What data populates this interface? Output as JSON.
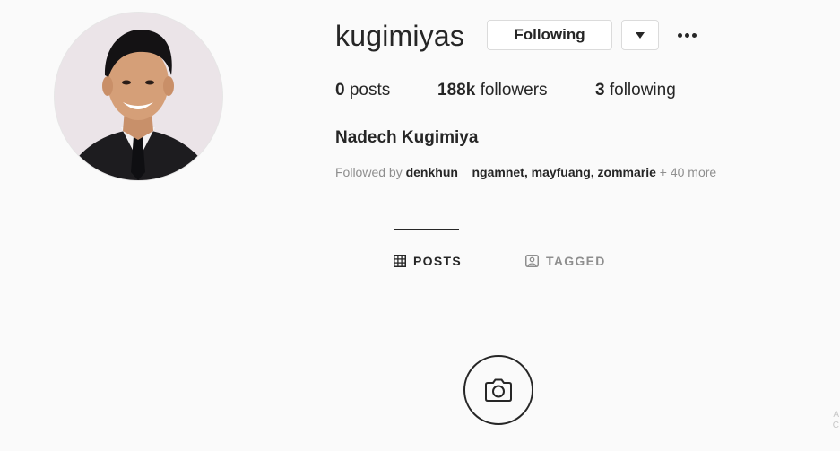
{
  "profile": {
    "username": "kugimiyas",
    "full_name": "Nadech Kugimiya",
    "avatar_alt": "profile-photo"
  },
  "actions": {
    "following_label": "Following",
    "dropdown_icon": "caret-down-icon",
    "more_icon": "more-horizontal-icon"
  },
  "stats": {
    "posts_count": "0",
    "posts_label": "posts",
    "followers_count": "188k",
    "followers_label": "followers",
    "following_count": "3",
    "following_label": "following"
  },
  "followed_by": {
    "prefix": "Followed by",
    "users": [
      "denkhun__ngamnet",
      "mayfuang",
      "zommarie"
    ],
    "more": "+ 40 more"
  },
  "tabs": [
    {
      "label": "POSTS",
      "icon": "grid-icon",
      "active": true
    },
    {
      "label": "TAGGED",
      "icon": "tagged-icon",
      "active": false
    }
  ],
  "empty_state": {
    "icon": "camera-icon"
  },
  "colors": {
    "background": "#fafafa",
    "text": "#262626",
    "secondary_text": "#8e8e8e",
    "border": "#dbdbdb"
  }
}
